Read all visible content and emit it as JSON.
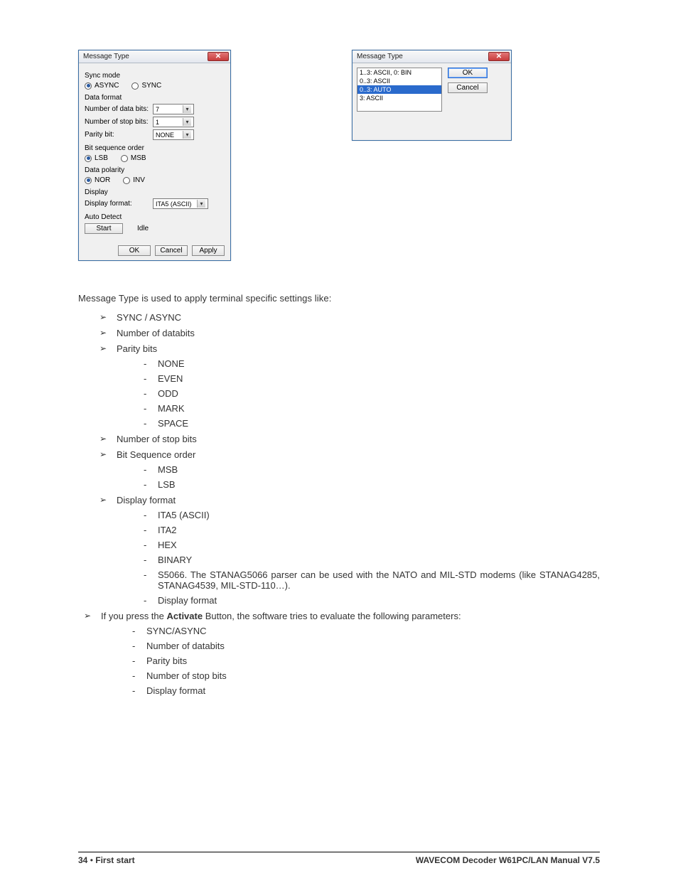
{
  "dialog1": {
    "title": "Message Type",
    "close_glyph": "✕",
    "sync_mode": {
      "label": "Sync mode",
      "opt_async": "ASYNC",
      "opt_sync": "SYNC"
    },
    "data_format": {
      "label": "Data format",
      "databits_label": "Number of data bits:",
      "databits_value": "7",
      "stopbits_label": "Number of stop bits:",
      "stopbits_value": "1",
      "parity_label": "Parity bit:",
      "parity_value": "NONE"
    },
    "bitseq": {
      "label": "Bit sequence order",
      "opt_lsb": "LSB",
      "opt_msb": "MSB"
    },
    "polarity": {
      "label": "Data polarity",
      "opt_nor": "NOR",
      "opt_inv": "INV"
    },
    "display": {
      "label": "Display",
      "fmt_label": "Display format:",
      "fmt_value": "ITA5 (ASCII)"
    },
    "autodetect": {
      "label": "Auto Detect",
      "start": "Start",
      "status": "Idle"
    },
    "buttons": {
      "ok": "OK",
      "cancel": "Cancel",
      "apply": "Apply"
    }
  },
  "dialog2": {
    "title": "Message Type",
    "close_glyph": "✕",
    "items": {
      "i0": "1..3: ASCII, 0: BIN",
      "i1": "0..3: ASCII",
      "i2": "0..3: AUTO",
      "i3": "3: ASCII"
    },
    "buttons": {
      "ok": "OK",
      "cancel": "Cancel"
    }
  },
  "body": {
    "intro": "Message Type is used to apply terminal specific settings like:",
    "l1_sync": "SYNC / ASYNC",
    "l1_databits": "Number of databits",
    "l1_parity": "Parity bits",
    "parity": {
      "none": "NONE",
      "even": "EVEN",
      "odd": "ODD",
      "mark": "MARK",
      "space": "SPACE"
    },
    "l1_stopbits": "Number of stop bits",
    "l1_bitseq": "Bit Sequence order",
    "bitseq": {
      "msb": "MSB",
      "lsb": "LSB"
    },
    "l1_display": "Display format",
    "disp": {
      "ita5": "ITA5 (ASCII)",
      "ita2": "ITA2",
      "hex": "HEX",
      "bin": "BINARY",
      "s5066": "S5066. The STANAG5066 parser can be used with the NATO and MIL-STD modems (like STANAG4285, STANAG4539, MIL-STD-110…).",
      "dispfmt": "Display format"
    },
    "activate_pre": "If you press the ",
    "activate_word": "Activate",
    "activate_post": " Button, the software tries to evaluate the following parameters:",
    "act": {
      "sync": "SYNC/ASYNC",
      "databits": "Number of databits",
      "parity": "Parity bits",
      "stopbits": "Number of stop bits",
      "display": "Display format"
    }
  },
  "footer": {
    "page": "34",
    "bullet": "•",
    "section": "First start",
    "right": "WAVECOM Decoder W61PC/LAN Manual V7.5"
  }
}
